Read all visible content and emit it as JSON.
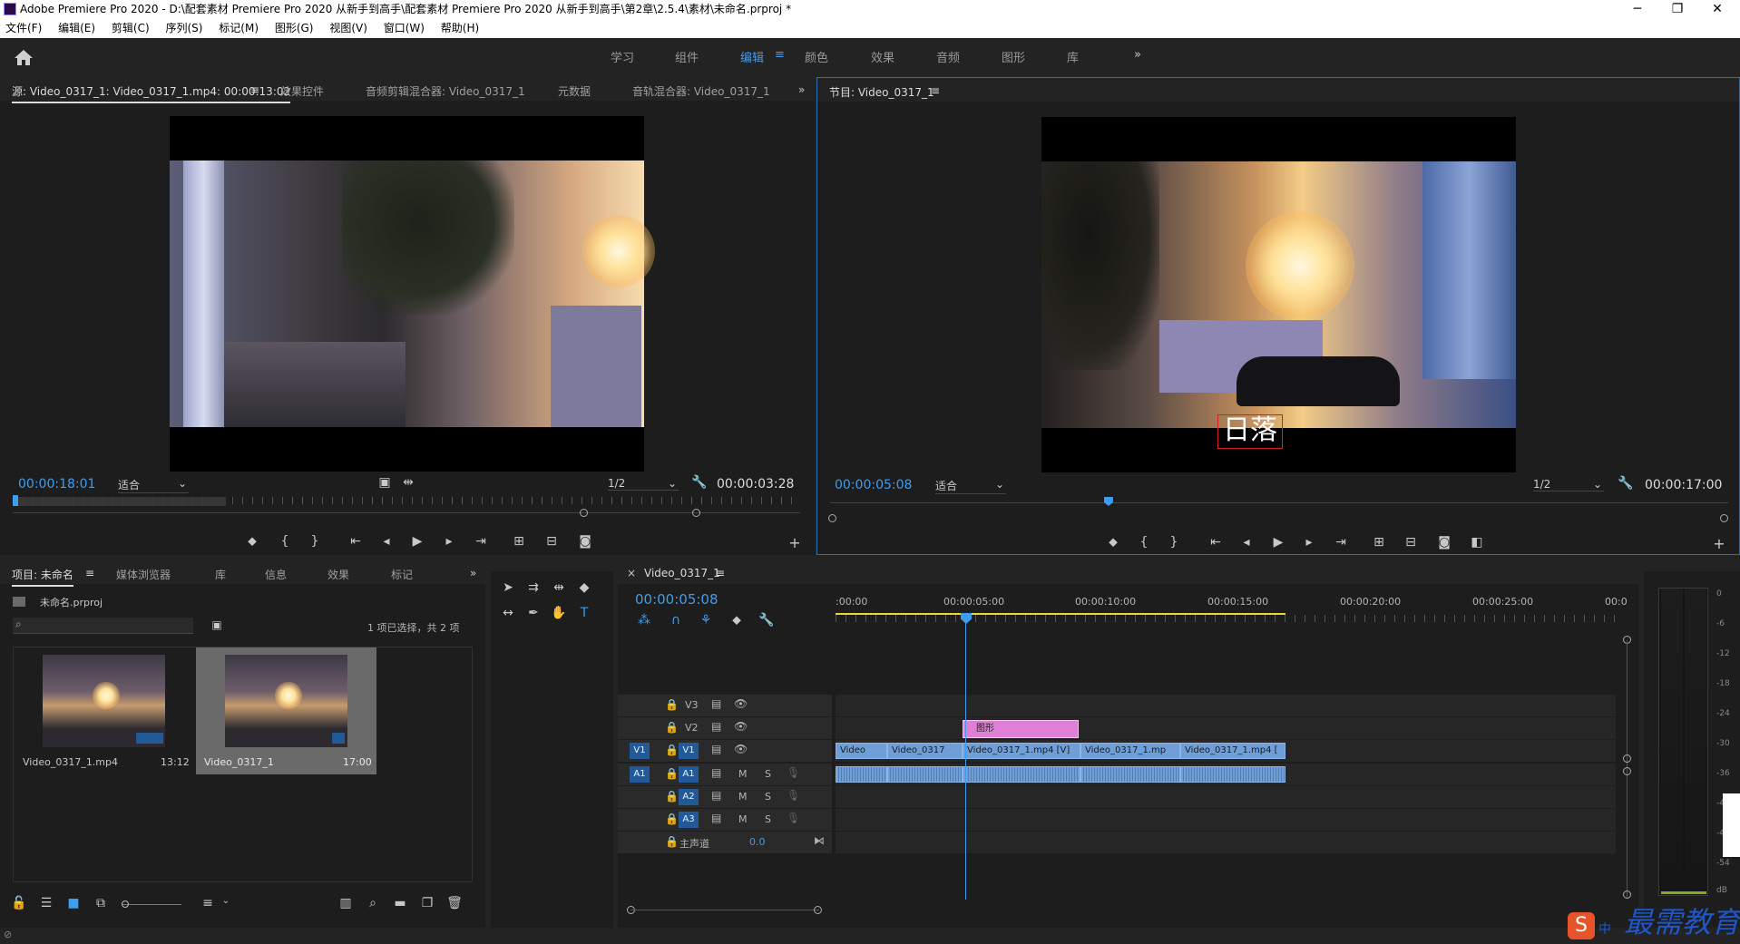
{
  "window": {
    "title": "Adobe Premiere Pro 2020 - D:\\配套素材 Premiere Pro 2020 从新手到高手\\配套素材 Premiere Pro 2020 从新手到高手\\第2章\\2.5.4\\素材\\未命名.prproj *",
    "controls": [
      "─",
      "❐",
      "✕"
    ]
  },
  "menu": [
    "文件(F)",
    "编辑(E)",
    "剪辑(C)",
    "序列(S)",
    "标记(M)",
    "图形(G)",
    "视图(V)",
    "窗口(W)",
    "帮助(H)"
  ],
  "workspaces": {
    "tabs": [
      "学习",
      "组件",
      "编辑",
      "颜色",
      "效果",
      "音频",
      "图形",
      "库"
    ],
    "active": "编辑",
    "more": "»"
  },
  "source_panel": {
    "tabs": [
      "源: Video_0317_1: Video_0317_1.mp4: 00:00:13:02",
      "效果控件",
      "音频剪辑混合器: Video_0317_1",
      "元数据",
      "音轨混合器: Video_0317_1"
    ],
    "timecode": "00:00:18:01",
    "fit": "适合",
    "resolution": "1/2",
    "duration": "00:00:03:28",
    "playhead_fraction": 0.01,
    "in_out_fraction": 0.27
  },
  "program_panel": {
    "tab": "节目: Video_0317_1",
    "timecode": "00:00:05:08",
    "fit": "适合",
    "resolution": "1/2",
    "duration": "00:00:17:00",
    "caption": "日落",
    "playhead_fraction": 0.31
  },
  "project_panel": {
    "tabs": [
      "项目: 未命名",
      "媒体浏览器",
      "库",
      "信息",
      "效果",
      "标记"
    ],
    "project_file": "未命名.prproj",
    "search_placeholder": "",
    "selection_info": "1 项已选择，共 2 项",
    "items": [
      {
        "name": "Video_0317_1.mp4",
        "duration": "13:12",
        "selected": false
      },
      {
        "name": "Video_0317_1",
        "duration": "17:00",
        "selected": true
      }
    ]
  },
  "timeline": {
    "tab": "Video_0317_1",
    "timecode": "00:00:05:08",
    "ruler": [
      ":00:00",
      "00:00:05:00",
      "00:00:10:00",
      "00:00:15:00",
      "00:00:20:00",
      "00:00:25:00",
      "00:0"
    ],
    "tracks_video": [
      "V3",
      "V2",
      "V1"
    ],
    "tracks_audio": [
      "A1",
      "A2",
      "A3"
    ],
    "master_label": "主声道",
    "master_value": "0.0",
    "graphic_clip": "图形",
    "v1_clips": [
      "Video",
      "Video_0317",
      "Video_0317_1.mp4 [V]",
      "Video_0317_1.mp",
      "Video_0317_1.mp4 ["
    ],
    "source_patch_v": "V1",
    "source_patch_a": "A1",
    "mute_label": "M",
    "solo_label": "S"
  },
  "meter": {
    "scale": [
      "0",
      "-6",
      "-12",
      "-18",
      "-24",
      "-30",
      "-36",
      "-42",
      "-48",
      "-54",
      "dB"
    ]
  },
  "watermark": {
    "text": "最需教育",
    "ime": "中"
  }
}
